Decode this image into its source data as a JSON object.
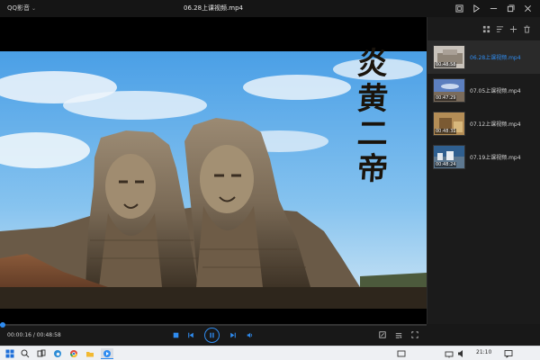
{
  "titlebar": {
    "app_name": "QQ影音",
    "title": "06.28上课视频.mp4"
  },
  "video": {
    "calligraphy": [
      "炎",
      "黄",
      "二",
      "帝"
    ]
  },
  "playlist": {
    "items": [
      {
        "name": "06.28上课视频.mp4",
        "duration": "00:48:58",
        "active": true
      },
      {
        "name": "07.05上课视频.mp4",
        "duration": "00:47:29",
        "active": false
      },
      {
        "name": "07.12上课视频.mp4",
        "duration": "00:48:31",
        "active": false
      },
      {
        "name": "07.19上课视频.mp4",
        "duration": "00:48:24",
        "active": false
      }
    ]
  },
  "controls": {
    "time": "00:00:16 / 00:48:58",
    "progress": 0.0054
  },
  "taskbar": {
    "clock": "21:10"
  },
  "colors": {
    "accent": "#2f8cf0",
    "background": "#141414",
    "sky": "#5aa8e6"
  }
}
